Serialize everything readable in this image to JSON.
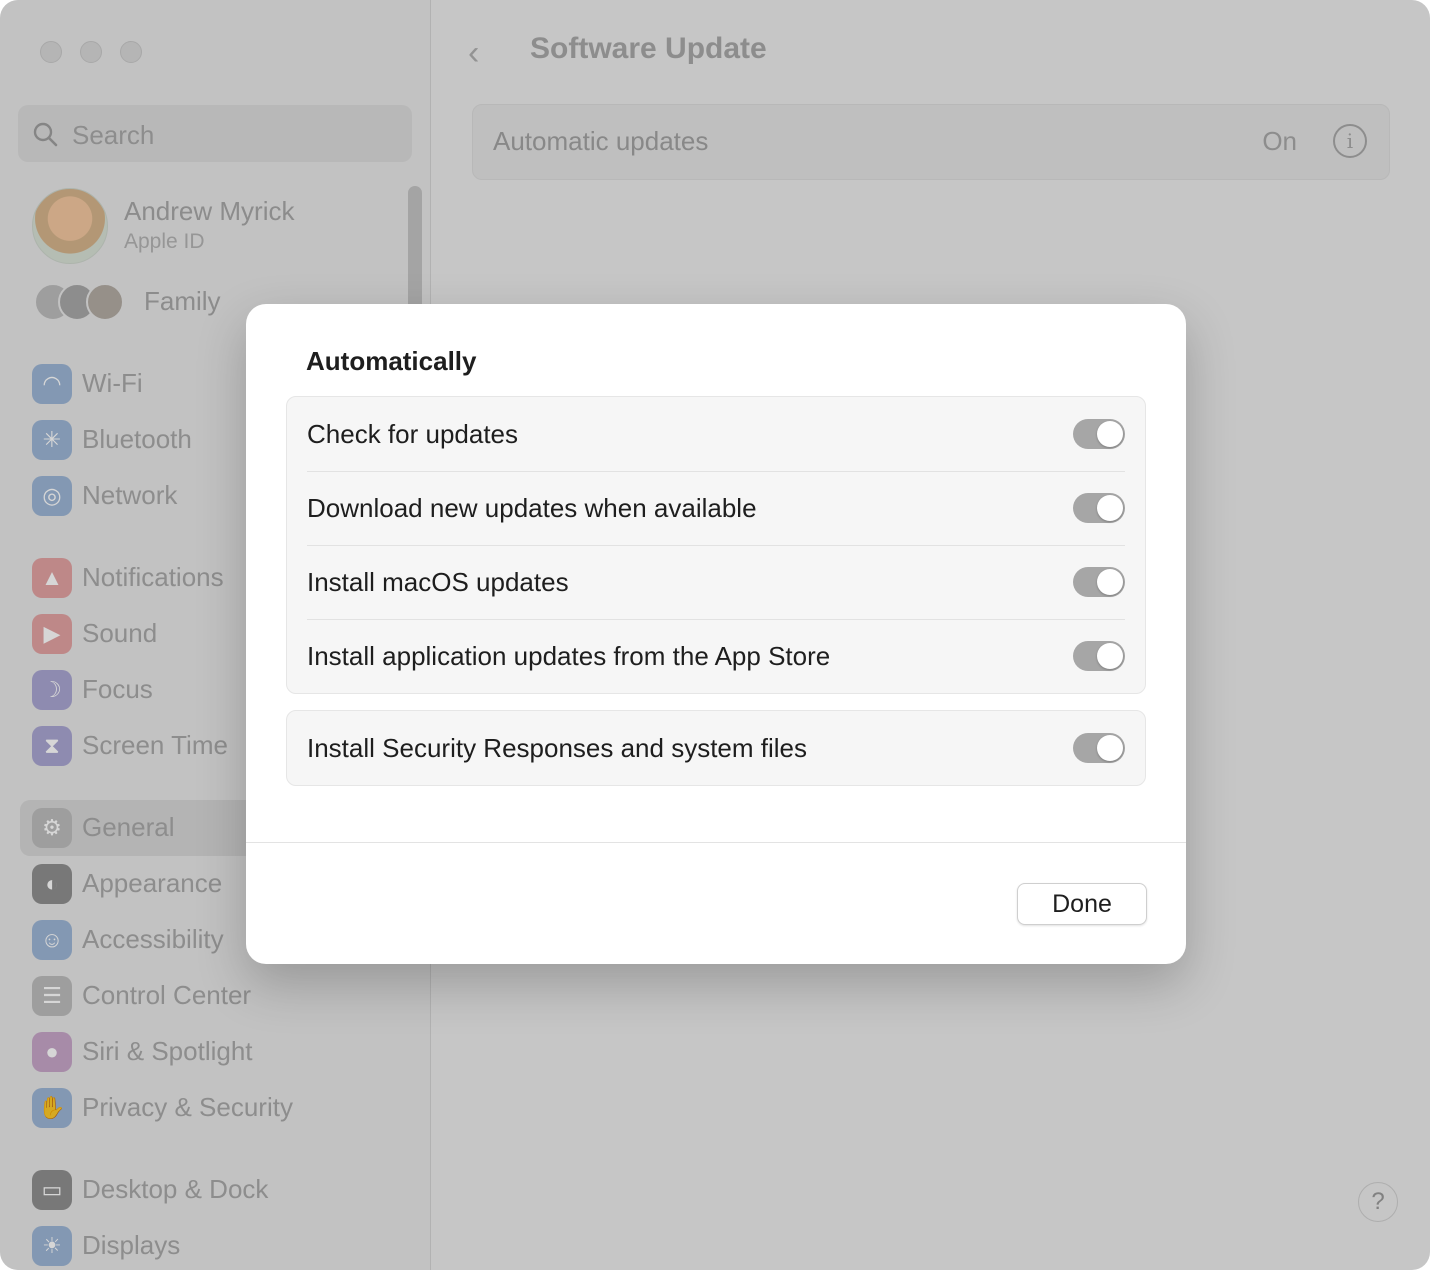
{
  "window": {
    "traffic_lights": [
      "close",
      "minimize",
      "zoom"
    ]
  },
  "sidebar": {
    "search_placeholder": "Search",
    "account": {
      "name": "Andrew Myrick",
      "subtitle": "Apple ID"
    },
    "family_label": "Family",
    "items": [
      {
        "label": "Wi-Fi",
        "icon": "wifi-icon",
        "color": "#9db6d6"
      },
      {
        "label": "Bluetooth",
        "icon": "bluetooth-icon",
        "color": "#9db6d6"
      },
      {
        "label": "Network",
        "icon": "globe-icon",
        "color": "#9db6d6"
      },
      {
        "label": "Notifications",
        "icon": "bell-icon",
        "color": "#e3a3a3"
      },
      {
        "label": "Sound",
        "icon": "speaker-icon",
        "color": "#e3a3a3"
      },
      {
        "label": "Focus",
        "icon": "moon-icon",
        "color": "#aaa6d2"
      },
      {
        "label": "Screen Time",
        "icon": "hourglass-icon",
        "color": "#aaa6d2"
      },
      {
        "label": "General",
        "icon": "gear-icon",
        "color": "#bdbdbd",
        "selected": true
      },
      {
        "label": "Appearance",
        "icon": "appearance-icon",
        "color": "#8f8f8f"
      },
      {
        "label": "Accessibility",
        "icon": "accessibility-icon",
        "color": "#9db6d6"
      },
      {
        "label": "Control Center",
        "icon": "control-center-icon",
        "color": "#bdbdbd"
      },
      {
        "label": "Siri & Spotlight",
        "icon": "siri-icon",
        "color": "#c7a6c9"
      },
      {
        "label": "Privacy & Security",
        "icon": "hand-icon",
        "color": "#9db6d6"
      },
      {
        "label": "Desktop & Dock",
        "icon": "dock-icon",
        "color": "#8f8f8f"
      },
      {
        "label": "Displays",
        "icon": "sun-icon",
        "color": "#9db6d6"
      }
    ]
  },
  "main": {
    "title": "Software Update",
    "automatic_updates": {
      "label": "Automatic updates",
      "value": "On"
    }
  },
  "sheet": {
    "title": "Automatically",
    "groups": [
      {
        "rows": [
          {
            "label": "Check for updates",
            "on": true
          },
          {
            "label": "Download new updates when available",
            "on": true
          },
          {
            "label": "Install macOS updates",
            "on": true
          },
          {
            "label": "Install application updates from the App Store",
            "on": true
          }
        ]
      },
      {
        "rows": [
          {
            "label": "Install Security Responses and system files",
            "on": true
          }
        ]
      }
    ],
    "done_label": "Done"
  },
  "help_label": "?"
}
